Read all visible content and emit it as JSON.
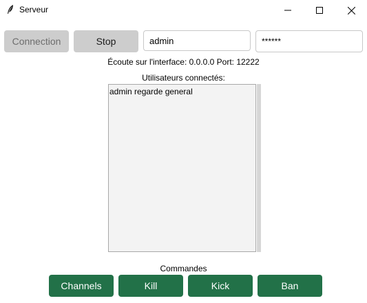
{
  "window": {
    "title": "Serveur",
    "icon": "feather-icon"
  },
  "toolbar": {
    "connection_label": "Connection",
    "stop_label": "Stop",
    "username_value": "admin",
    "password_value": "******"
  },
  "status": {
    "text": "Écoute sur l'interface: 0.0.0.0 Port: 12222"
  },
  "users": {
    "label": "Utilisateurs connectés:",
    "items": [
      "admin regarde general"
    ]
  },
  "commands": {
    "label": "Commandes",
    "buttons": [
      "Channels",
      "Kill",
      "Kick",
      "Ban"
    ]
  },
  "colors": {
    "command_button_bg": "#227148",
    "gray_button_bg": "#cdcdcd",
    "listbox_bg": "#f3f3f3"
  }
}
